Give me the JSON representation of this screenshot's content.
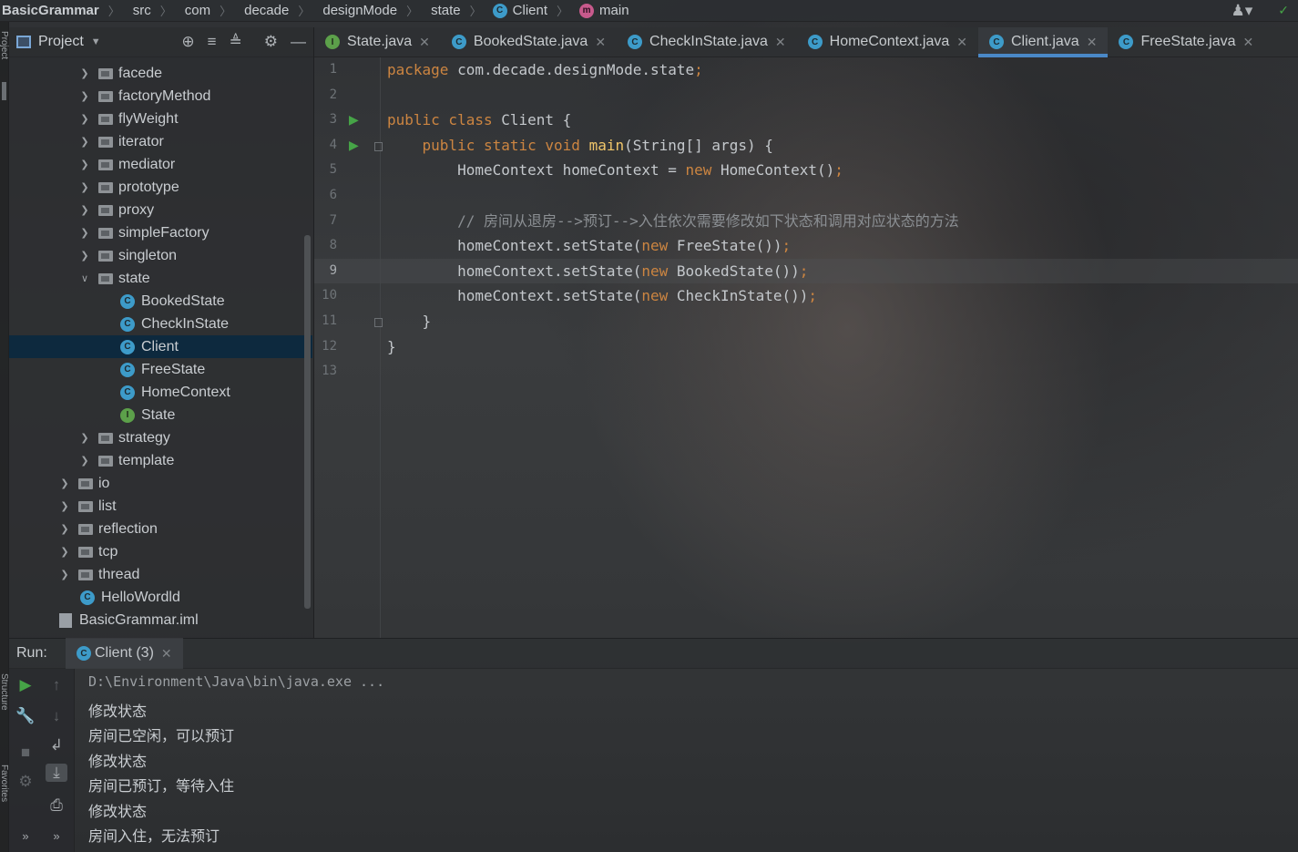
{
  "navbar": {
    "crumbs": [
      "BasicGrammar",
      "src",
      "com",
      "decade",
      "designMode",
      "state",
      "Client",
      "main"
    ]
  },
  "left_strip": {
    "project_label": "Project",
    "structure_label": "Structure",
    "favorites_label": "Favorites"
  },
  "project_panel": {
    "title": "Project",
    "tree": [
      {
        "label": "facede",
        "type": "folder",
        "expanded": false,
        "indent": 1
      },
      {
        "label": "factoryMethod",
        "type": "folder",
        "expanded": false,
        "indent": 1
      },
      {
        "label": "flyWeight",
        "type": "folder",
        "expanded": false,
        "indent": 1
      },
      {
        "label": "iterator",
        "type": "folder",
        "expanded": false,
        "indent": 1
      },
      {
        "label": "mediator",
        "type": "folder",
        "expanded": false,
        "indent": 1
      },
      {
        "label": "prototype",
        "type": "folder",
        "expanded": false,
        "indent": 1
      },
      {
        "label": "proxy",
        "type": "folder",
        "expanded": false,
        "indent": 1
      },
      {
        "label": "simpleFactory",
        "type": "folder",
        "expanded": false,
        "indent": 1
      },
      {
        "label": "singleton",
        "type": "folder",
        "expanded": false,
        "indent": 1
      },
      {
        "label": "state",
        "type": "folder",
        "expanded": true,
        "indent": 1
      },
      {
        "label": "BookedState",
        "type": "class",
        "indent": 2
      },
      {
        "label": "CheckInState",
        "type": "class",
        "indent": 2
      },
      {
        "label": "Client",
        "type": "class-main",
        "indent": 2,
        "selected": true
      },
      {
        "label": "FreeState",
        "type": "class",
        "indent": 2
      },
      {
        "label": "HomeContext",
        "type": "class",
        "indent": 2
      },
      {
        "label": "State",
        "type": "interface",
        "indent": 2
      },
      {
        "label": "strategy",
        "type": "folder",
        "expanded": false,
        "indent": 1
      },
      {
        "label": "template",
        "type": "folder",
        "expanded": false,
        "indent": 1
      },
      {
        "label": "io",
        "type": "folder",
        "expanded": false,
        "indent": 0
      },
      {
        "label": "list",
        "type": "folder",
        "expanded": false,
        "indent": 0
      },
      {
        "label": "reflection",
        "type": "folder",
        "expanded": false,
        "indent": 0
      },
      {
        "label": "tcp",
        "type": "folder",
        "expanded": false,
        "indent": 0
      },
      {
        "label": "thread",
        "type": "folder",
        "expanded": false,
        "indent": 0
      },
      {
        "label": "HelloWordld",
        "type": "class-main",
        "indent": -1
      },
      {
        "label": "BasicGrammar.iml",
        "type": "file",
        "indent": -2
      }
    ]
  },
  "tabs": [
    {
      "label": "State.java",
      "icon": "I",
      "active": false
    },
    {
      "label": "BookedState.java",
      "icon": "C",
      "active": false
    },
    {
      "label": "CheckInState.java",
      "icon": "C",
      "active": false
    },
    {
      "label": "HomeContext.java",
      "icon": "C",
      "active": false
    },
    {
      "label": "Client.java",
      "icon": "C",
      "active": true
    },
    {
      "label": "FreeState.java",
      "icon": "C",
      "active": false
    }
  ],
  "editor": {
    "current_line": 9,
    "line_numbers": [
      "1",
      "2",
      "3",
      "4",
      "5",
      "6",
      "7",
      "8",
      "9",
      "10",
      "11",
      "12",
      "13"
    ],
    "lines": [
      [
        {
          "t": "package ",
          "c": "kw"
        },
        {
          "t": "com.decade.designMode.state",
          "c": "ty"
        },
        {
          "t": ";",
          "c": "kw"
        }
      ],
      [],
      [
        {
          "t": "public class ",
          "c": "kw"
        },
        {
          "t": "Client {",
          "c": "ty"
        }
      ],
      [
        {
          "t": "    public static void ",
          "c": "kw"
        },
        {
          "t": "main",
          "c": "fn"
        },
        {
          "t": "(String[] args) {",
          "c": "ty"
        }
      ],
      [
        {
          "t": "        HomeContext homeContext = ",
          "c": "ty"
        },
        {
          "t": "new ",
          "c": "kw"
        },
        {
          "t": "HomeContext()",
          "c": "ty"
        },
        {
          "t": ";",
          "c": "kw"
        }
      ],
      [],
      [
        {
          "t": "        // 房间从退房-->预订-->入住依次需要修改如下状态和调用对应状态的方法",
          "c": "cmt"
        }
      ],
      [
        {
          "t": "        homeContext.setState(",
          "c": "ty"
        },
        {
          "t": "new ",
          "c": "kw"
        },
        {
          "t": "FreeState())",
          "c": "ty"
        },
        {
          "t": ";",
          "c": "kw"
        }
      ],
      [
        {
          "t": "        homeContext.setState(",
          "c": "ty"
        },
        {
          "t": "new ",
          "c": "kw"
        },
        {
          "t": "BookedState())",
          "c": "ty"
        },
        {
          "t": ";",
          "c": "kw"
        }
      ],
      [
        {
          "t": "        homeContext.setState(",
          "c": "ty"
        },
        {
          "t": "new ",
          "c": "kw"
        },
        {
          "t": "CheckInState())",
          "c": "ty"
        },
        {
          "t": ";",
          "c": "kw"
        }
      ],
      [
        {
          "t": "    }",
          "c": "ty"
        }
      ],
      [
        {
          "t": "}",
          "c": "ty"
        }
      ],
      []
    ],
    "run_gutter_lines": [
      3,
      4
    ]
  },
  "run_panel": {
    "label": "Run:",
    "tab_label": "Client (3)",
    "console": [
      "D:\\Environment\\Java\\bin\\java.exe ...",
      "修改状态",
      "房间已空闲，可以预订",
      "修改状态",
      "房间已预订，等待入住",
      "修改状态",
      "房间入住，无法预订"
    ]
  },
  "colors": {
    "keyword": "#cc8541",
    "function": "#f0c66a",
    "comment": "#8b8f93",
    "selection": "#0d293e",
    "accent": "#4a88c7"
  }
}
